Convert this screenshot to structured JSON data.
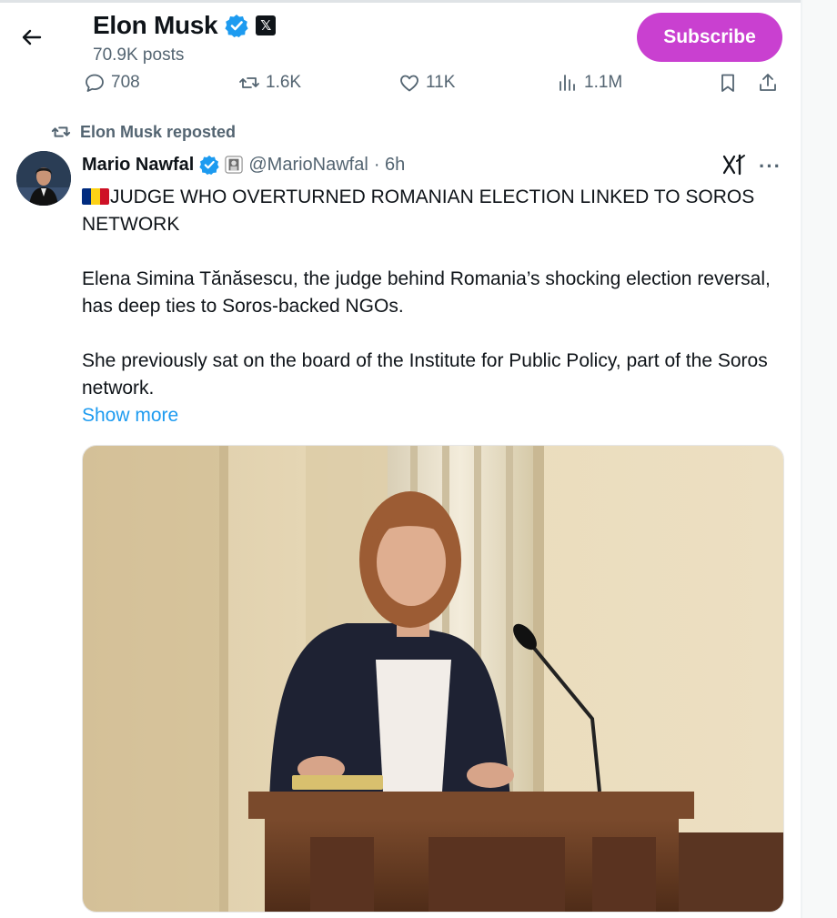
{
  "header": {
    "name": "Elon Musk",
    "x_badge": "𝕏",
    "posts": "70.9K posts",
    "subscribe_label": "Subscribe"
  },
  "actions": {
    "replies": "708",
    "reposts": "1.6K",
    "likes": "11K",
    "views": "1.1M"
  },
  "repost_label": "Elon Musk reposted",
  "tweet": {
    "author_name": "Mario Nawfal",
    "handle": "@MarioNawfal",
    "time": "· 6h",
    "headline": "JUDGE WHO OVERTURNED ROMANIAN ELECTION LINKED TO SOROS NETWORK",
    "para1": "Elena Simina Tănăsescu, the judge behind Romania’s shocking election reversal, has deep ties to Soros-backed NGOs.",
    "para2": "She previously sat on the board of the Institute for Public Policy, part of the Soros network.",
    "show_more": "Show more"
  },
  "colors": {
    "accent": "#1d9bf0",
    "subscribe": "#c940d0",
    "muted": "#536471",
    "flag": [
      "#002B7F",
      "#FCD116",
      "#CE1126"
    ]
  }
}
